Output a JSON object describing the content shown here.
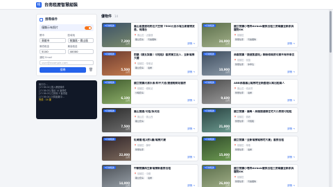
{
  "app": {
    "title": "台南租屋智慧組裝",
    "logo_glyph": "租"
  },
  "filters": {
    "panel_title": "搜尋條件",
    "toggle_label": "僅顯示有照片",
    "toggle_on": true,
    "city_label": "縣市",
    "city_value": "高雄市",
    "district_label": "區域地",
    "district_value": "前鎮區・鳳山區",
    "rent_min_label": "最低租金",
    "rent_min_value": "5100",
    "rent_max_label": "最高租金",
    "rent_max_value": "40000",
    "email_label": "通知 Email",
    "email_placeholder": "user@example.com",
    "search_label": "搜尋"
  },
  "console": {
    "lines": [
      "執行中…",
      "[17:38:02] 載入篩選條件",
      "[17:38:03] 搜尋 14 筆物件",
      "[17:38:03] 已排除 3 筆重複",
      "[17:38:04] 計算距離中…"
    ],
    "highlight": "完成：14 筆"
  },
  "main": {
    "title": "優物件",
    "count": "14"
  },
  "cards": [
    {
      "badge": "5月後租賃",
      "price": "7,200",
      "unit": "元/月",
      "title": "鳳山區捷運站附近大空間 7500元含水電瓦斯寵物友善，有陽台",
      "loc": "鳳山區・近捷運",
      "tags": [
        "獨立套房",
        "可養寵物"
      ],
      "link": "詳情 →",
      "c1": "#3a5068",
      "c2": "#7a8a6b"
    },
    {
      "badge": "5月後租賃",
      "price": "24,000",
      "unit": "元/月",
      "title": "國立前鎮小巷弄Airbnb優質出租三房兩廳全新家具寵物OK",
      "loc": "前鎮區",
      "tags": [
        "整層住家",
        "可養寵物"
      ],
      "link": "詳情 →",
      "c1": "#5a6d4a",
      "c2": "#a3b18a"
    },
    {
      "badge": "5月後租賃",
      "price": "5,500",
      "unit": "元/月",
      "title": "前鎮【捷五梨園｜可短租】套房獨立出入．全新電梯大樓",
      "loc": "前鎮區・草衙站",
      "tags": [
        "獨立套房",
        "電梯"
      ],
      "link": "詳情 →",
      "c1": "#6b3a2f",
      "c2": "#c27a4e"
    },
    {
      "badge": "5月後租賃",
      "price": "10,900",
      "unit": "元/月",
      "title": "高雄前鎮「捷運凱旋站」精裝修兩房可開伙有停車位",
      "loc": "前鎮區・凱旋",
      "tags": [
        "整層住家",
        "停車位"
      ],
      "link": "詳情 →",
      "c1": "#3b4a5c",
      "c2": "#8c9aa8"
    },
    {
      "badge": "5月後租賃",
      "price": "6,100",
      "unit": "元/月",
      "title": "國立前鎮河濱水景/和平大道/捷運輕軌站套房",
      "loc": "前鎮區・輕軌站",
      "tags": [
        "分租套房"
      ],
      "link": "詳情 →",
      "c1": "#3f5a2e",
      "c2": "#8fb06a"
    },
    {
      "badge": "5月後租賃",
      "price": "9,600",
      "unit": "元/月",
      "title": "ABB高雄鳳山電梯宅全新整理公寓出租兩人",
      "loc": "鳳山區・衛武營",
      "tags": [
        "整層住家",
        "電梯"
      ],
      "link": "詳情 →",
      "c1": "#4b4b4b",
      "c2": "#9b9b9b"
    },
    {
      "badge": "5月後租賃",
      "price": "7,500",
      "unit": "元/月",
      "title": "鳳山捷運/可租/採光佳",
      "loc": "鳳山區・鳳山西",
      "tags": [
        "獨立套房"
      ],
      "link": "詳情 →",
      "c1": "#2a2a2a",
      "c2": "#6e6e6e"
    },
    {
      "badge": "5月後租賃",
      "price": "21,000",
      "unit": "元/月",
      "title": "國立前鎮・鳳峰・高雄捷運線住宅大小房間可短租",
      "loc": "前鎮區・鳳峰",
      "tags": [
        "整層住家",
        "可短租"
      ],
      "link": "詳情 →",
      "c1": "#27403f",
      "c2": "#6c9a8f"
    },
    {
      "badge": "5月後租賃",
      "price": "22,000",
      "unit": "元/月",
      "title": "紅磚屋/租2房1廳/電梯大廈",
      "loc": "前鎮區・獅甲",
      "tags": [
        "整層住家"
      ],
      "link": "詳情 →",
      "c1": "#30252a",
      "c2": "#7d6a5c"
    },
    {
      "badge": "5月後租賃",
      "price": "15,000",
      "unit": "元/月",
      "title": "國立前鎮「全新電梯電梯宅大廈」套房出租",
      "loc": "前鎮區・草衙",
      "tags": [
        "整層住家",
        "電梯"
      ],
      "link": "詳情 →",
      "c1": "#2f4a2a",
      "c2": "#6d9a52"
    },
    {
      "badge": "5月後租賃",
      "price": "14,000",
      "unit": "元/月",
      "title": "中鋼前鎮再生新電梯新套房出租",
      "loc": "前鎮區・中鋼",
      "tags": [
        "獨立套房",
        "電梯"
      ],
      "link": "詳情 →",
      "c1": "#4a4f55",
      "c2": "#9ba3ab"
    },
    {
      "badge": "5月後租賃",
      "price": "26,000",
      "unit": "元/月",
      "title": "國立前鎮小巷弄Airbnb優質出租三房兩廳全新家具寵物OK",
      "loc": "前鎮區",
      "tags": [
        "整層住家",
        "可養寵物"
      ],
      "link": "詳情 →",
      "c1": "#5a6d4a",
      "c2": "#a3b18a"
    }
  ]
}
